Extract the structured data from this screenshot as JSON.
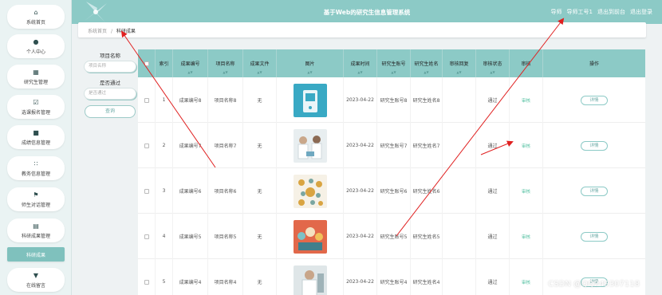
{
  "header": {
    "title": "基于Web的研究生信息管理系统",
    "links": [
      "导师",
      "导师工号1",
      "退出到前台",
      "退出登录"
    ]
  },
  "sidebar": {
    "items": [
      {
        "label": "系统首页",
        "icon": "home-icon"
      },
      {
        "label": "个人中心",
        "icon": "user-icon"
      },
      {
        "label": "研究生管理",
        "icon": "grid-icon"
      },
      {
        "label": "选课报名管理",
        "icon": "checkbox-icon"
      },
      {
        "label": "成绩信息管理",
        "icon": "monitor-icon"
      },
      {
        "label": "教务信息管理",
        "icon": "apps-icon"
      },
      {
        "label": "师生对话管理",
        "icon": "flag-icon"
      },
      {
        "label": "科研成果管理",
        "icon": "document-icon"
      },
      {
        "label": "科研成果",
        "icon": ""
      },
      {
        "label": "在线留言",
        "icon": "message-icon"
      }
    ]
  },
  "breadcrumb": {
    "home": "系统首页",
    "sep": "/",
    "current": "科研成果"
  },
  "search": {
    "name_label": "项目名称",
    "name_placeholder": "项目名称",
    "pass_label": "是否通过",
    "pass_placeholder": "是否通过",
    "query_label": "查询"
  },
  "table": {
    "columns": [
      "",
      "索引",
      "成果编号",
      "项目名称",
      "成果文件",
      "图片",
      "成果时间",
      "研究生账号",
      "研究生姓名",
      "审核回复",
      "审核状态",
      "审核",
      "操作"
    ],
    "rows": [
      {
        "index": "1",
        "code": "成果编号8",
        "project": "项目名称8",
        "file": "无",
        "img": "pic-8",
        "time": "2023-04-22",
        "account": "研究生账号8",
        "name": "研究生姓名8",
        "reply": "",
        "status": "通过",
        "audit": "审核",
        "action": "详情"
      },
      {
        "index": "2",
        "code": "成果编号7",
        "project": "项目名称7",
        "file": "无",
        "img": "pic-7",
        "time": "2023-04-22",
        "account": "研究生账号7",
        "name": "研究生姓名7",
        "reply": "",
        "status": "通过",
        "audit": "审核",
        "action": "详情"
      },
      {
        "index": "3",
        "code": "成果编号6",
        "project": "项目名称6",
        "file": "无",
        "img": "pic-6",
        "time": "2023-04-22",
        "account": "研究生账号6",
        "name": "研究生姓名6",
        "reply": "",
        "status": "通过",
        "audit": "审核",
        "action": "详情"
      },
      {
        "index": "4",
        "code": "成果编号5",
        "project": "项目名称5",
        "file": "无",
        "img": "pic-5",
        "time": "2023-04-22",
        "account": "研究生账号5",
        "name": "研究生姓名5",
        "reply": "",
        "status": "通过",
        "audit": "审核",
        "action": "详情"
      },
      {
        "index": "5",
        "code": "成果编号4",
        "project": "项目名称4",
        "file": "无",
        "img": "pic-4",
        "time": "2023-04-22",
        "account": "研究生账号4",
        "name": "研究生姓名4",
        "reply": "",
        "status": "通过",
        "audit": "审核",
        "action": "详情"
      }
    ]
  },
  "watermark": "CSDN @QQ249307118",
  "colors": {
    "accent": "#8ccac6",
    "arrow": "#e02020",
    "audit_link": "#4fbf9f"
  }
}
